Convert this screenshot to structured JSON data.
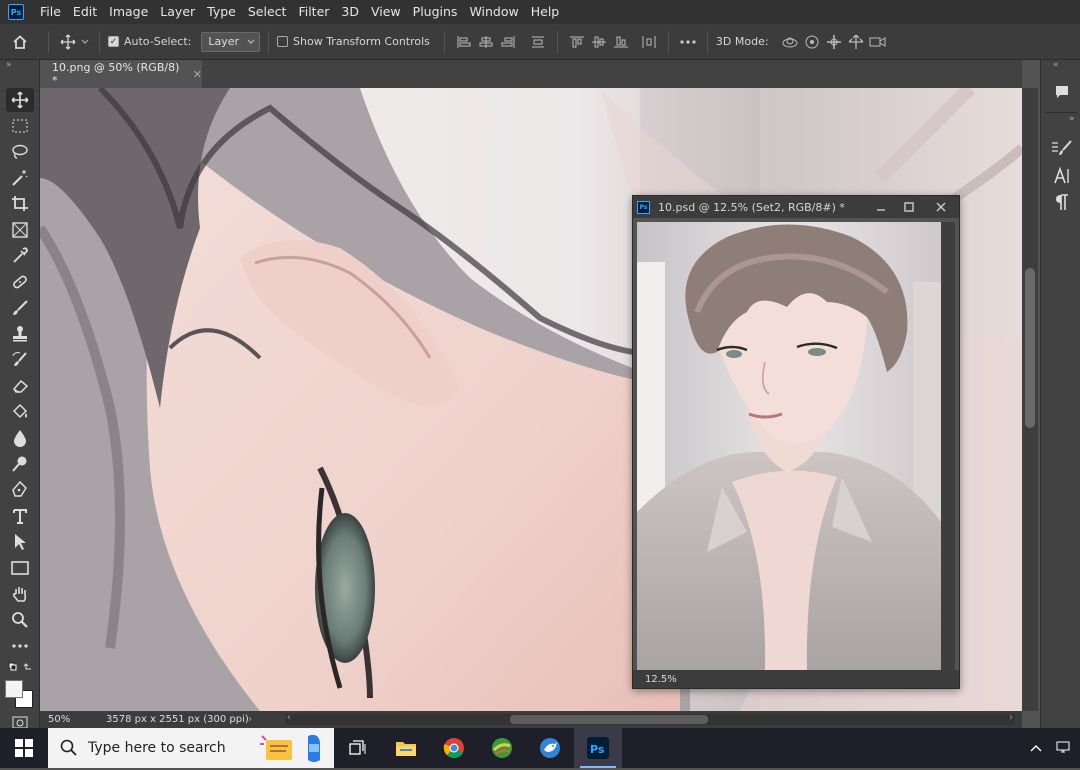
{
  "menu": {
    "items": [
      "File",
      "Edit",
      "Image",
      "Layer",
      "Type",
      "Select",
      "Filter",
      "3D",
      "View",
      "Plugins",
      "Window",
      "Help"
    ]
  },
  "options": {
    "auto_select_label": "Auto-Select:",
    "auto_select_checked": true,
    "layer_select_value": "Layer",
    "show_transform_label": "Show Transform Controls",
    "show_transform_checked": false,
    "mode_3d_label": "3D Mode:"
  },
  "document": {
    "tab_title": "10.png @ 50% (RGB/8) *",
    "zoom": "50%",
    "info": "3578 px x 2551 px (300 ppi)"
  },
  "float_window": {
    "title": "10.psd @ 12.5% (Set2, RGB/8#) *",
    "zoom": "12.5%"
  },
  "taskbar": {
    "search_placeholder": "Type here to search"
  },
  "colors": {
    "accent": "#31a8ff",
    "chrome_dark": "#323232",
    "panel": "#424242",
    "workspace": "#535353"
  }
}
